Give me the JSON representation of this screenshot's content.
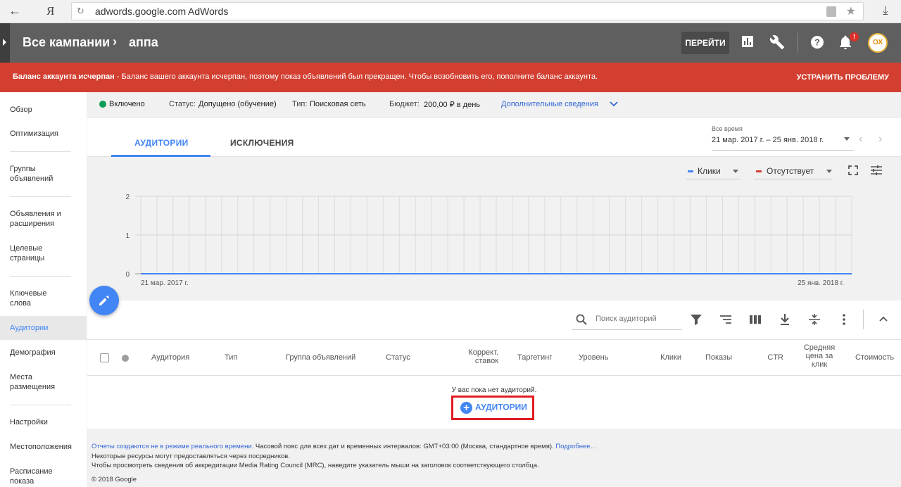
{
  "browser": {
    "back_icon": "back-arrow-icon",
    "search_brand": "Я",
    "url_host": "adwords.google.com",
    "url_title": "AdWords",
    "download_icon": "download-icon"
  },
  "header": {
    "title": "Все кампании",
    "separator": "›",
    "subtitle": "аппа",
    "go_button": "ПЕРЕЙТИ",
    "notification_badge": "!",
    "avatar_text": "ОХ"
  },
  "alert": {
    "bold_text": "Баланс аккаунта исчерпан",
    "text": " - Баланс вашего аккаунта исчерпан, поэтому показ объявлений был прекращен. Чтобы возобновить его, пополните баланс аккаунта.",
    "fix_button": "УСТРАНИТЬ ПРОБЛЕМУ",
    "color": "#d23f31"
  },
  "sidebar": {
    "items": [
      {
        "label": "Обзор"
      },
      {
        "label": "Оптимизация"
      },
      {
        "label": "Группы объявлений"
      },
      {
        "label": "Объявления и расширения"
      },
      {
        "label": "Целевые страницы"
      },
      {
        "label": "Ключевые слова"
      },
      {
        "label": "Аудитории",
        "active": true
      },
      {
        "label": "Демография"
      },
      {
        "label": "Места размещения"
      },
      {
        "label": "Настройки"
      },
      {
        "label": "Местоположения"
      },
      {
        "label": "Расписание показа"
      }
    ]
  },
  "status": {
    "state": "Включено",
    "status_label": "Статус:",
    "status_value": "Допущено (обучение)",
    "type_label": "Тип:",
    "type_value": "Поисковая сеть",
    "budget_label": "Бюджет:",
    "budget_value": "200,00 ₽ в день",
    "more_link": "Дополнительные сведения"
  },
  "tabs": [
    {
      "label": "АУДИТОРИИ",
      "active": true
    },
    {
      "label": "ИСКЛЮЧЕНИЯ",
      "active": false
    }
  ],
  "date_range": {
    "label": "Все время",
    "value": "21 мар. 2017 г. – 25 янв. 2018 г."
  },
  "legend": {
    "metric1": "Клики",
    "metric1_color": "#4285f4",
    "metric2": "Отсутствует",
    "metric2_color": "#d23f31"
  },
  "chart_data": {
    "type": "line",
    "y_ticks": [
      "2",
      "1",
      "0"
    ],
    "ylim": [
      0,
      2
    ],
    "x_start_label": "21 мар. 2017 г.",
    "x_end_label": "25 янв. 2018 г.",
    "series": [
      {
        "name": "Клики",
        "values": [
          0,
          0
        ]
      }
    ],
    "grid": true
  },
  "table": {
    "search_placeholder": "Поиск аудиторий",
    "columns": [
      "Аудитория",
      "Тип",
      "Группа объявлений",
      "Статус",
      "Коррект. ставок",
      "Таргетинг",
      "Уровень",
      "Клики",
      "Показы",
      "CTR",
      "Средняя цена за клик",
      "Стоимость"
    ],
    "empty_message": "У вас пока нет аудиторий.",
    "add_button": "АУДИТОРИИ"
  },
  "footer": {
    "line1_link": "Отчеты создаются не в режиме реального времени.",
    "line1_text": " Часовой пояс для всех дат и временных интервалов: GMT+03:00 (Москва, стандартное время).",
    "line1_more": "Подробнее…",
    "line2": "Некоторые ресурсы могут предоставляться через посредников.",
    "line3": "Чтобы просмотреть сведения об аккредитации Media Rating Council (MRC), наведите указатель мыши на заголовок соответствующего столбца.",
    "copyright": "© 2018 Google"
  }
}
